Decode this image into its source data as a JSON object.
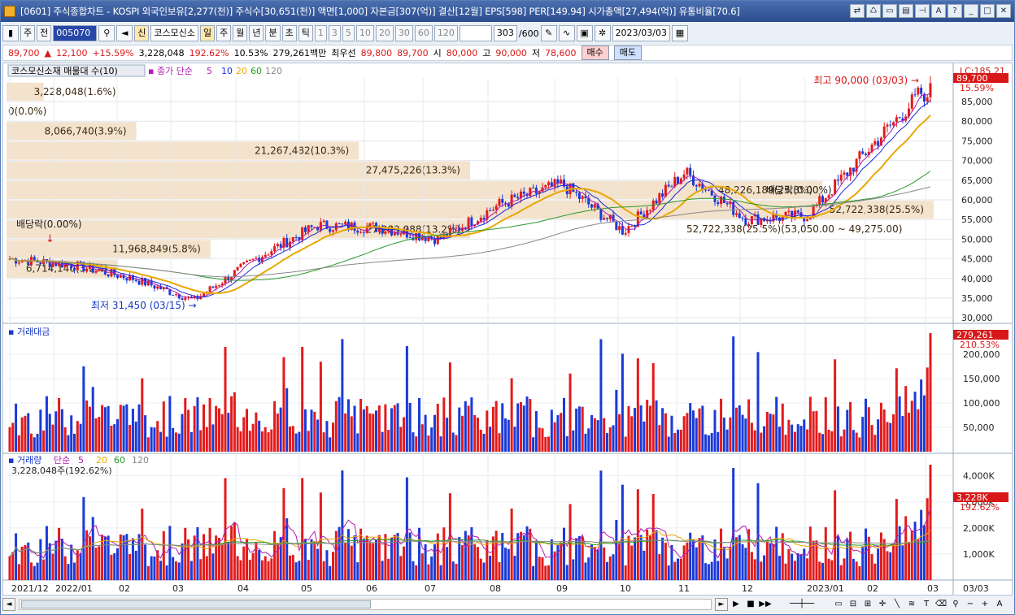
{
  "window": {
    "title": "[0601] 주식종합차트 - KOSPI 외국인보유[2,277(천)] 주식수[30,651(천)] 액면[1,000] 자본금[307(억)] 결산[12월] EPS[598] PER[149.94] 시가총액[27,494(억)] 유통비율[70.6]"
  },
  "toolbar": {
    "period_select": "주",
    "prev_label": "전",
    "code_value": "005070",
    "search_icon": "search-icon",
    "sound_icon": "speaker-icon",
    "sin_label": "신",
    "stock_name": "코스모신소",
    "periods": [
      "일",
      "주",
      "월",
      "년",
      "분",
      "초",
      "틱"
    ],
    "active_period": "일",
    "intervals": [
      "1",
      "3",
      "5",
      "10",
      "20",
      "30",
      "60",
      "120"
    ],
    "count_value": "303",
    "count_total": "/600",
    "date_value": "2023/03/03"
  },
  "quote": {
    "price": "89,700",
    "arrow": "▲",
    "change": "12,100",
    "change_pct": "+15.59%",
    "volume": "3,228,048",
    "volume_ratio": "192.62%",
    "turnover": "10.53%",
    "amount": "279,261백만",
    "best_label": "최우선",
    "best_ask": "89,800",
    "best_bid": "89,700",
    "open_label": "시",
    "open": "80,000",
    "high_label": "고",
    "high": "90,000",
    "low_label": "저",
    "low": "78,600",
    "buy_label": "매수",
    "sell_label": "매도"
  },
  "chart_header": {
    "title": "코스모신소재 매물대 수(10)",
    "ma_label": "종가 단순",
    "ma_periods": [
      "5",
      "10",
      "20",
      "60",
      "120"
    ],
    "lc": "LC:185.21"
  },
  "annotations": {
    "high_text": "최고 90,000 (03/03)",
    "low_text": "최저 31,450 (03/15)",
    "dividend1": "배당락(0.00%)",
    "dividend2": "배당락(0.00%)",
    "last_price_tag": "89,700",
    "last_pct_tag": "15.59%",
    "range_text": "52,722,338(25.5%)(53,050.00 ~ 49,275.00)"
  },
  "volume_profile": [
    {
      "label": "3,228,048(1.6%)",
      "price": 87500,
      "frac": 0.04
    },
    {
      "label": "0(0.0%)",
      "price": 82500,
      "frac": 0.0
    },
    {
      "label": "8,066,740(3.9%)",
      "price": 77500,
      "frac": 0.14
    },
    {
      "label": "21,267,482(10.3%)",
      "price": 72500,
      "frac": 0.38
    },
    {
      "label": "27,475,226(13.3%)",
      "price": 67500,
      "frac": 0.5
    },
    {
      "label": "48,226,189(23.3%)",
      "price": 62500,
      "frac": 0.88
    },
    {
      "label": "52,722,338(25.5%)",
      "price": 57500,
      "frac": 1.0
    },
    {
      "label": "27,283,088(13.2%)",
      "price": 52500,
      "frac": 0.5
    },
    {
      "label": "11,968,849(5.8%)",
      "price": 47500,
      "frac": 0.22
    },
    {
      "label": "6,714,140(3.2%)",
      "price": 42500,
      "frac": 0.12
    }
  ],
  "price_axis": [
    "85,000",
    "80,000",
    "75,000",
    "70,000",
    "65,000",
    "60,000",
    "55,000",
    "50,000",
    "45,000",
    "40,000",
    "35,000",
    "30,000"
  ],
  "amount_panel": {
    "title": "거래대금",
    "axis": [
      "200,000",
      "150,000",
      "100,000",
      "50,000"
    ],
    "last_tag": "279,261",
    "pct_tag": "210.53%"
  },
  "volume_panel": {
    "title": "거래량",
    "ma_label": "단순",
    "ma_periods": [
      "5",
      "20",
      "60",
      "120"
    ],
    "sub_label": "3,228,048주(192.62%)",
    "axis": [
      "4,000K",
      "3,000K",
      "2,000K",
      "1,000K"
    ],
    "last_tag": "3,228K",
    "pct_tag": "192.62%"
  },
  "x_axis": [
    "2021/12",
    "2022/01",
    "02",
    "03",
    "04",
    "05",
    "06",
    "07",
    "08",
    "09",
    "10",
    "11",
    "12",
    "2023/01",
    "02",
    "03"
  ],
  "x_axis_right": "03/03",
  "colors": {
    "up": "#e41a1a",
    "down": "#1a3ad8",
    "ma5": "#b01cb0",
    "ma10": "#1a2ad8",
    "ma20": "#e8a800",
    "ma60": "#2a9a2a",
    "ma120": "#888888",
    "profile": "#f3e2cc"
  },
  "chart_data": {
    "type": "candlestick",
    "description_series": "weekly closes (approximate, read from chart)",
    "x": [
      "2021/12",
      "2022/01",
      "2022/02",
      "2022/03",
      "2022/04",
      "2022/05",
      "2022/06",
      "2022/07",
      "2022/08",
      "2022/09",
      "2022/10",
      "2022/11",
      "2022/12",
      "2023/01",
      "2023/02",
      "2023/03"
    ],
    "close": [
      45000,
      43500,
      40000,
      34500,
      45000,
      53500,
      53000,
      50000,
      59000,
      64000,
      52000,
      67000,
      55000,
      56000,
      73000,
      89700
    ],
    "ylim": [
      29000,
      91000
    ]
  }
}
